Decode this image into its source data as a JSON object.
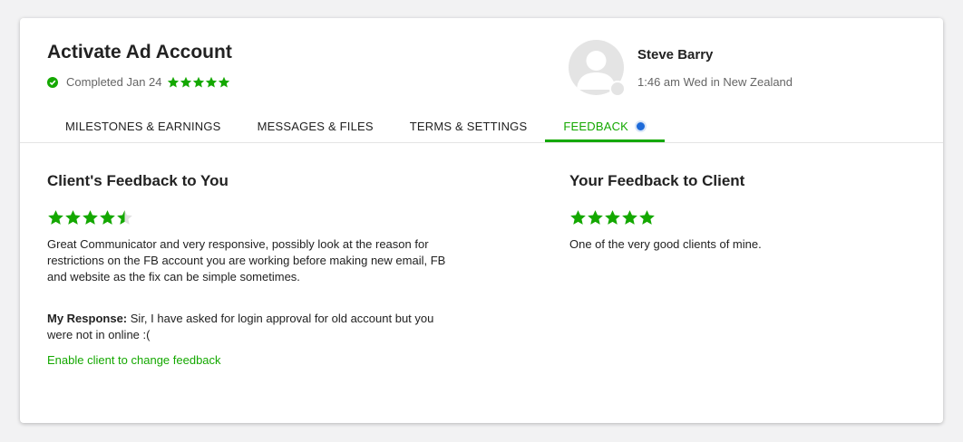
{
  "header": {
    "title": "Activate Ad Account",
    "status": "Completed Jan 24",
    "status_rating": 5
  },
  "client": {
    "name": "Steve Barry",
    "local_time": "1:46 am Wed in New Zealand"
  },
  "tabs": [
    {
      "label": "MILESTONES & EARNINGS"
    },
    {
      "label": "MESSAGES & FILES"
    },
    {
      "label": "TERMS & SETTINGS"
    },
    {
      "label": "FEEDBACK",
      "active": true
    }
  ],
  "client_feedback": {
    "heading": "Client's Feedback to You",
    "rating": 4.5,
    "comment": "Great Communicator and very responsive, possibly look at the reason for restrictions on the FB account you are working before making new email, FB and website as the fix can be simple sometimes.",
    "response_label": "My Response:",
    "response_text": "Sir, I have asked for login approval for old account but you were not in online :(",
    "enable_link": "Enable client to change feedback"
  },
  "your_feedback": {
    "heading": "Your Feedback to Client",
    "rating": 5,
    "comment": "One of the very good clients of mine."
  },
  "colors": {
    "accent_green": "#14a800",
    "notification_blue": "#1d6ad9",
    "star_empty": "#e0e0e0"
  }
}
